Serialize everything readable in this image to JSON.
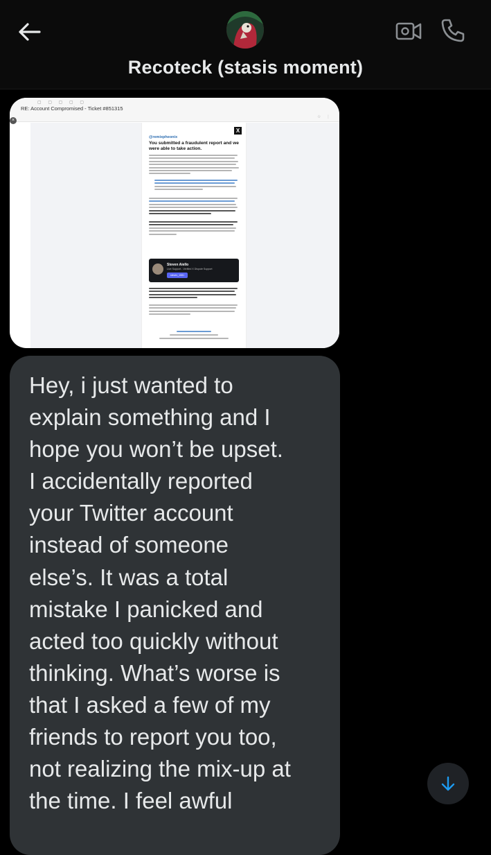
{
  "header": {
    "title": "Recoteck (stasis moment)",
    "back_icon": "arrow-left-icon",
    "video_icon": "video-camera-icon",
    "call_icon": "phone-icon"
  },
  "attachment": {
    "subject": "RE: Account Compromised - Ticket #851315",
    "handle": "@remixpheonix",
    "heading": "You submitted a fraudulent report and we were able to take action.",
    "card_name": "Steven Aiello",
    "card_sub": "Live Support - Verified X Dispute Support",
    "card_button": "steven_1081"
  },
  "message": {
    "text": "Hey, i just wanted to\nexplain something and I\nhope you won’t be upset.\nI accidentally reported\nyour Twitter account\ninstead of someone\nelse’s. It was a total\nmistake I panicked and\nacted too quickly without\nthinking. What’s worse is\nthat I asked a few of my\nfriends to report you too,\nnot realizing the mix-up at\nthe time. I feel awful"
  },
  "scroll": {
    "icon": "arrow-down-icon"
  },
  "colors": {
    "background": "#000000",
    "bubble": "#2f3336",
    "text": "#e7e9ea",
    "accent": "#1d9bf0"
  }
}
